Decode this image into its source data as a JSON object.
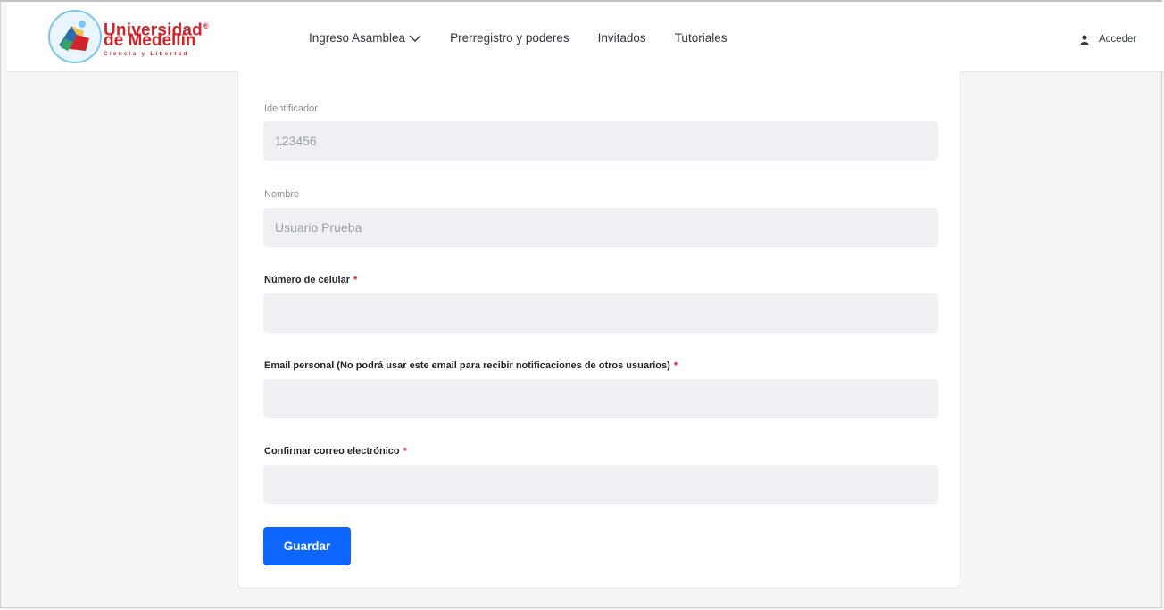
{
  "brand": {
    "line1": "Universidad",
    "registered": "®",
    "line2": "de Medellín",
    "tagline": "Ciencia y Libertad",
    "color": "#d2232a"
  },
  "nav": {
    "items": [
      {
        "label": "Ingreso Asamblea",
        "has_dropdown": true
      },
      {
        "label": "Prerregistro y poderes"
      },
      {
        "label": "Invitados"
      },
      {
        "label": "Tutoriales"
      }
    ],
    "login_label": "Acceder",
    "login_icon": "user-icon"
  },
  "form": {
    "required_mark": "*",
    "fields": [
      {
        "label": "Identificador",
        "value": "123456",
        "readonly": true,
        "required": false
      },
      {
        "label": "Nombre",
        "value": "Usuario Prueba",
        "readonly": true,
        "required": false
      },
      {
        "label": "Número de celular",
        "value": "",
        "readonly": false,
        "required": true
      },
      {
        "label": "Email personal (No podrá usar este email para recibir notificaciones de otros usuarios)",
        "value": "",
        "readonly": false,
        "required": true
      },
      {
        "label": "Confirmar correo electrónico",
        "value": "",
        "readonly": false,
        "required": true
      }
    ],
    "submit_label": "Guardar"
  },
  "colors": {
    "primary": "#0d66ff",
    "required": "#d2232a",
    "input_bg": "#eef0f4",
    "page_bg": "#f5f5f6"
  }
}
